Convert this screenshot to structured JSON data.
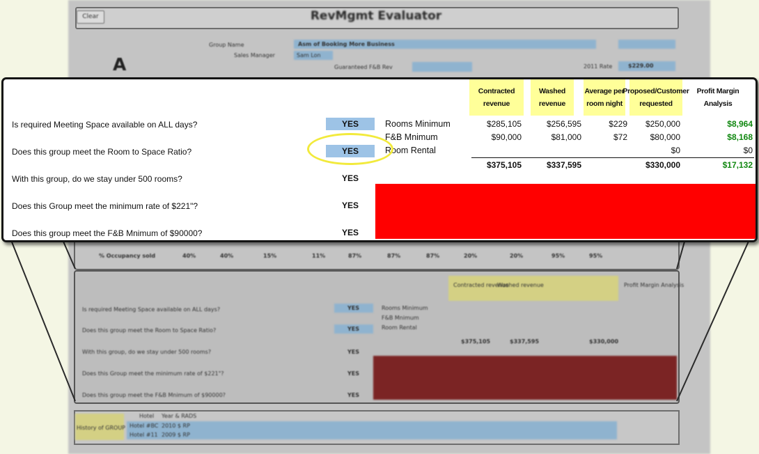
{
  "background": {
    "clear_button": "Clear",
    "title": "RevMgmt Evaluator",
    "section_letter": "A",
    "group_name_label": "Group Name",
    "group_name_value": "Asm of Booking More Business",
    "sales_manager_label": "Sales Manager",
    "sales_manager_value": "Sam Lon",
    "guaranteed_fb_label": "Guaranteed F&B Rev",
    "rate_label": "2011 Rate",
    "rate_value": "$229.00",
    "occupancy_label": "% Occupancy sold",
    "occupancy_values": [
      "40%",
      "40%",
      "15%",
      "11%",
      "87%",
      "87%",
      "87%",
      "20%",
      "20%",
      "95%",
      "95%"
    ],
    "history_label": "History of GROUP",
    "history_cols": [
      "Hotel",
      "Year & RADS"
    ],
    "history_rows": [
      [
        "Hotel #BC",
        "2010 $ RP"
      ],
      [
        "Hotel #11",
        "2009 $ RP"
      ]
    ]
  },
  "zoom": {
    "questions": [
      {
        "text": "Is required Meeting Space available on ALL days?",
        "answer": "YES",
        "highlighted": true
      },
      {
        "text": "Does this group meet the Room to Space Ratio?",
        "answer": "YES",
        "highlighted": true
      },
      {
        "text": "With this group, do we stay under 500 rooms?",
        "answer": "YES",
        "highlighted": false
      },
      {
        "text": "Does this Group meet the minimum rate of $221\"?",
        "answer": "YES",
        "highlighted": false
      },
      {
        "text": "Does this group meet the F&B Mnimum of $90000?",
        "answer": "YES",
        "highlighted": false
      }
    ],
    "headers": {
      "contracted": "Contracted revenue",
      "washed": "Washed revenue",
      "average": "Average per room night",
      "proposed": "Proposed/Customer requested",
      "profit": "Profit Margin Analysis"
    },
    "rows": [
      {
        "label": "Rooms Minimum",
        "contracted": "$285,105",
        "washed": "$256,595",
        "average": "$229",
        "proposed": "$250,000",
        "profit": "$8,964"
      },
      {
        "label": "F&B Mnimum",
        "contracted": "$90,000",
        "washed": "$81,000",
        "average": "$72",
        "proposed": "$80,000",
        "profit": "$8,168"
      },
      {
        "label": "Room Rental",
        "contracted": "",
        "washed": "",
        "average": "",
        "proposed": "$0",
        "profit": "$0"
      }
    ],
    "totals": {
      "contracted": "$375,105",
      "washed": "$337,595",
      "proposed": "$330,000",
      "profit": "$17,132"
    }
  },
  "colors": {
    "highlight_yellow": "#ffff99",
    "yes_blue": "#9dc3e6",
    "alert_red": "#ff0000",
    "profit_green": "#118811",
    "ellipse_yellow": "#f2ea3c"
  }
}
